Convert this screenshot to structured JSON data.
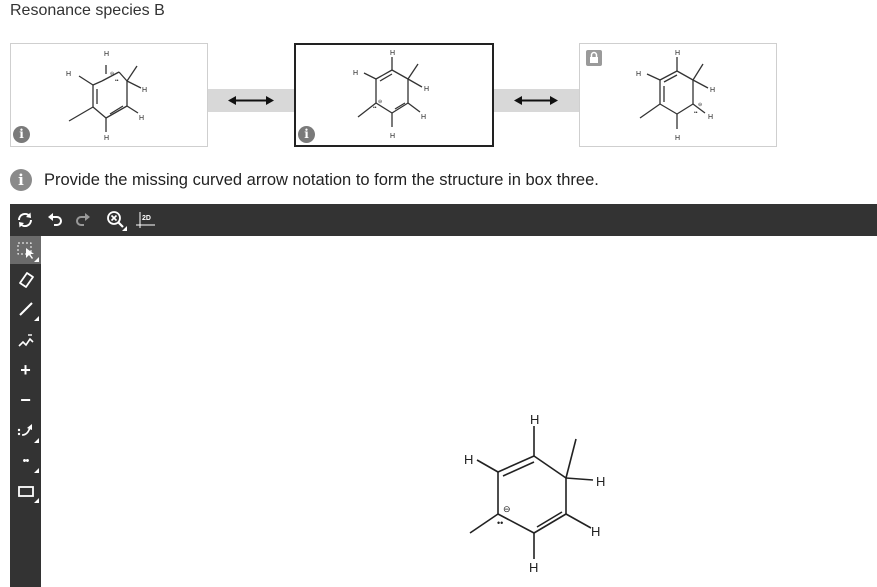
{
  "page": {
    "title": "Resonance species B"
  },
  "instruction": {
    "text": "Provide the missing curved arrow notation to form the structure in box three."
  },
  "structure_labels": {
    "hydrogen": "H",
    "negative_charge": "⊖",
    "lone_pair": "••"
  },
  "boxes": [
    {
      "name": "box-1",
      "selected": false,
      "icon": "info-icon"
    },
    {
      "name": "box-2",
      "selected": true,
      "icon": "info-icon"
    },
    {
      "name": "box-3",
      "selected": false,
      "icon": "lock-icon"
    }
  ],
  "connectors": [
    {
      "icon": "double-headed-arrow-icon"
    },
    {
      "icon": "double-headed-arrow-icon"
    }
  ],
  "toolbar_top": {
    "buttons": [
      {
        "icon": "refresh-icon"
      },
      {
        "icon": "undo-icon"
      },
      {
        "icon": "redo-icon"
      },
      {
        "icon": "zoom-reset-icon"
      },
      {
        "icon": "clean-2d-icon",
        "label": "2D"
      }
    ]
  },
  "toolbar_left": {
    "buttons": [
      {
        "icon": "select-icon",
        "active": true
      },
      {
        "icon": "eraser-icon"
      },
      {
        "icon": "bond-icon"
      },
      {
        "icon": "chain-icon"
      },
      {
        "icon": "positive-charge-icon",
        "label": "+"
      },
      {
        "icon": "negative-charge-icon",
        "label": "−"
      },
      {
        "icon": "curved-arrow-icon"
      },
      {
        "icon": "lone-pair-icon",
        "label": "••"
      },
      {
        "icon": "rectangle-icon"
      }
    ]
  },
  "colors": {
    "toolbar_bg": "#333333",
    "connector_bg": "#d8d8d8",
    "box_border": "#cfcfcf",
    "selected_border": "#222222",
    "info_icon": "#7a7a7a"
  }
}
